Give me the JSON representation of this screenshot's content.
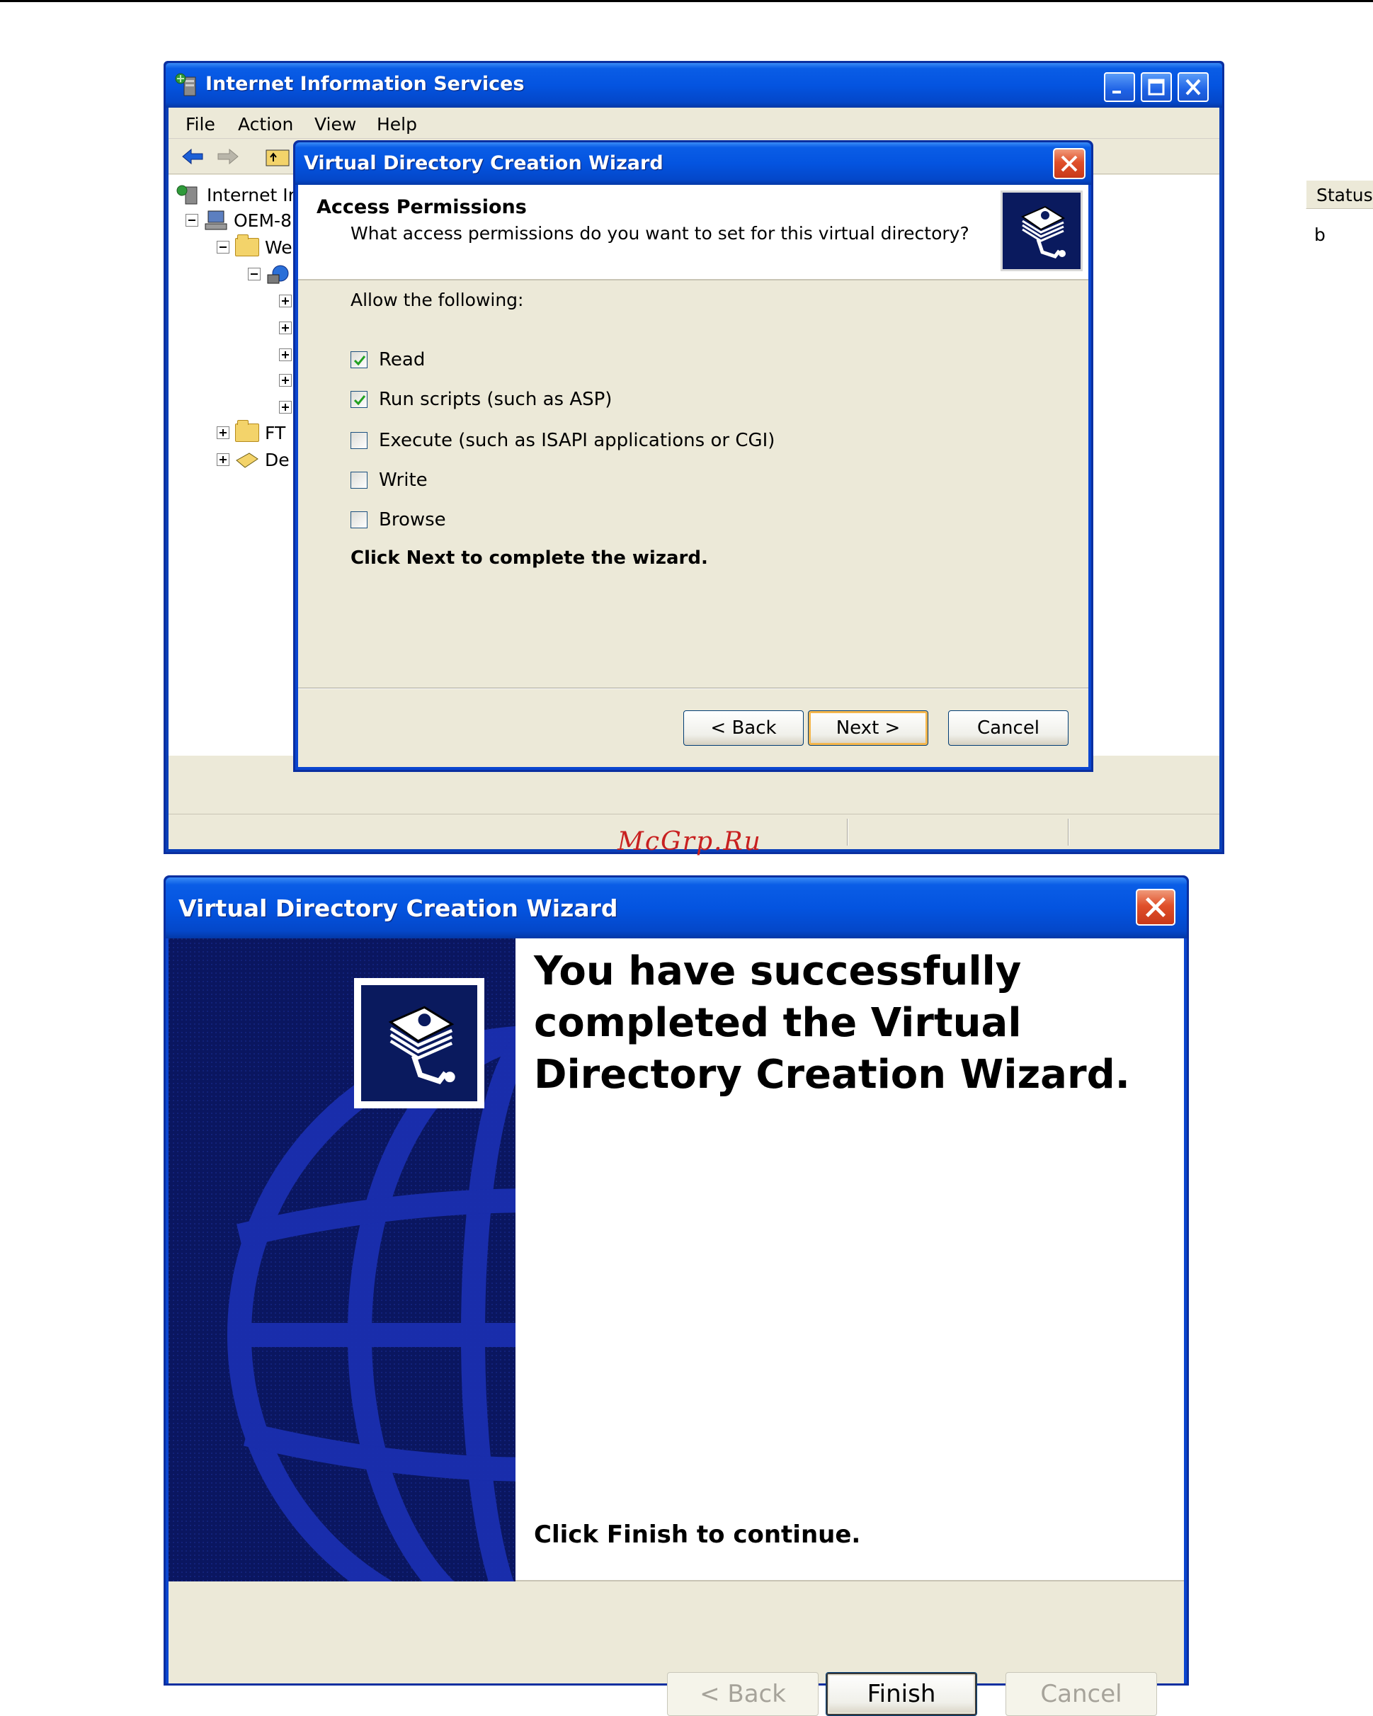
{
  "iis_window": {
    "title": "Internet Information Services",
    "menu": [
      "File",
      "Action",
      "View",
      "Help"
    ],
    "tree": {
      "root": "Internet Ir",
      "computer": "OEM-8",
      "web_sites": "We",
      "ftp_sites": "FT",
      "default": "De"
    },
    "list_header": {
      "status": "Status"
    },
    "list_fragment": "b"
  },
  "wizard1": {
    "title": "Virtual Directory Creation Wizard",
    "header_title": "Access Permissions",
    "header_subtitle": "What access permissions do you want to set for this virtual directory?",
    "allow_label": "Allow the following:",
    "permissions": [
      {
        "label": "Read",
        "checked": true
      },
      {
        "label": "Run scripts (such as ASP)",
        "checked": true
      },
      {
        "label": "Execute (such as ISAPI applications or CGI)",
        "checked": false
      },
      {
        "label": "Write",
        "checked": false
      },
      {
        "label": "Browse",
        "checked": false
      }
    ],
    "hint": "Click Next to complete the wizard.",
    "buttons": {
      "back": "< Back",
      "next": "Next >",
      "cancel": "Cancel"
    }
  },
  "wizard2": {
    "title": "Virtual Directory Creation Wizard",
    "success_message": "You have successfully completed the Virtual Directory Creation Wizard.",
    "continue_text": "Click Finish to continue.",
    "buttons": {
      "back": "< Back",
      "finish": "Finish",
      "cancel": "Cancel"
    }
  },
  "watermark": "McGrp.Ru",
  "colors": {
    "titlebar_blue": "#0454e0",
    "dialog_face": "#ece9d8",
    "close_red": "#e0502a",
    "watermark_red": "#c82020",
    "sidebar_navy": "#0a1660"
  }
}
